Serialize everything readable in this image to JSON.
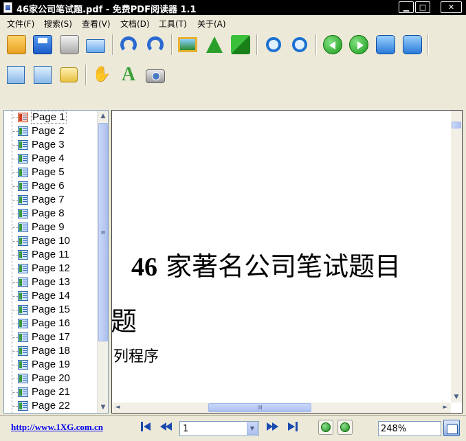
{
  "window": {
    "title": "46家公司笔试题.pdf - 免费PDF阅读器 1.1",
    "min_label": "▁",
    "max_label": "□",
    "close_label": "✕"
  },
  "menu": [
    "文件(F)",
    "搜索(S)",
    "查看(V)",
    "文档(D)",
    "工具(T)",
    "关于(A)"
  ],
  "toolbar": {
    "row1": [
      "open-folder-icon",
      "save-icon",
      "print-icon",
      "email-icon",
      "undo-icon",
      "redo-icon",
      "image-icon",
      "arrow-up-icon",
      "swap-icon",
      "zoom-in-icon",
      "zoom-out-icon",
      "prev-page-icon",
      "next-page-icon",
      "first-page-icon",
      "last-page-icon"
    ],
    "row2": [
      "page-view-icon",
      "multi-page-icon",
      "scroll-icon",
      "hand-tool-icon",
      "text-select-icon",
      "snapshot-icon"
    ],
    "text_tool_glyph": "A",
    "hand_glyph": "✋"
  },
  "pages": [
    "Page 1",
    "Page 2",
    "Page 3",
    "Page 4",
    "Page 5",
    "Page 6",
    "Page 7",
    "Page 8",
    "Page 9",
    "Page 10",
    "Page 11",
    "Page 12",
    "Page 13",
    "Page 14",
    "Page 15",
    "Page 16",
    "Page 17",
    "Page 18",
    "Page 19",
    "Page 20",
    "Page 21",
    "Page 22"
  ],
  "selected_page": "Page 1",
  "document": {
    "title_number": "46",
    "title_text": " 家著名公司笔试题目",
    "title_cont": "题",
    "subtext": "列程序"
  },
  "scroll": {
    "up": "▲",
    "down": "▼",
    "left": "◄",
    "right": "►",
    "grip": "≡",
    "hgrip": "III"
  },
  "statusbar": {
    "url": "http://www.1XG.com.cn",
    "page_value": "1",
    "dropdown_arrow": "▼",
    "zoom": "248%"
  },
  "colors": {
    "accent": "#1a4ab0",
    "titlebar": "#000000",
    "link": "#0000ee"
  }
}
